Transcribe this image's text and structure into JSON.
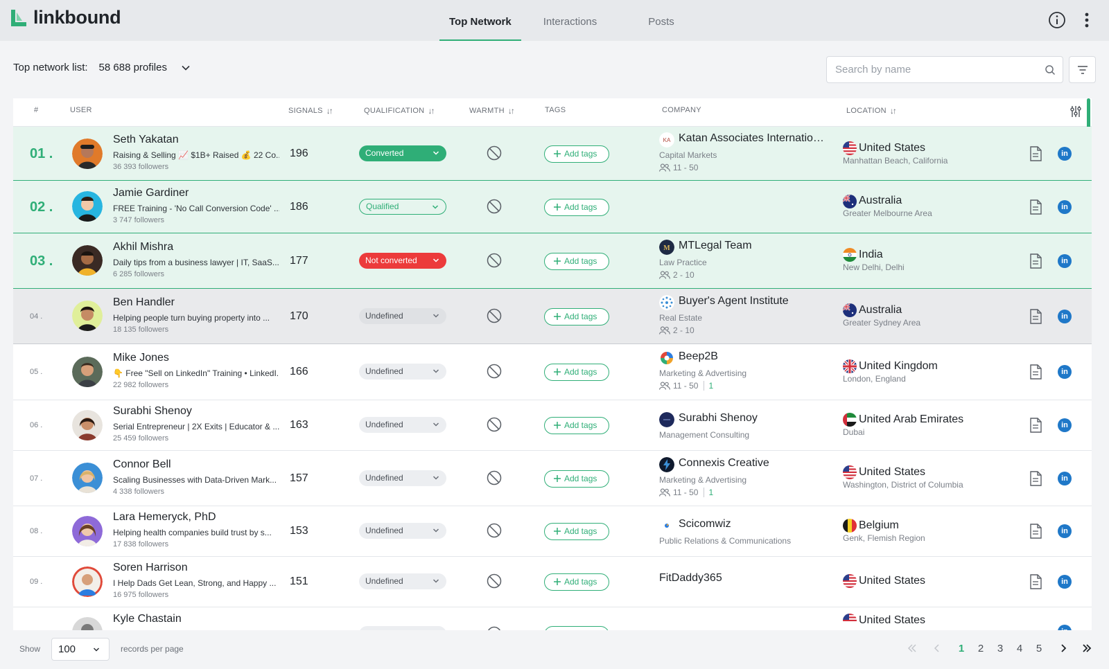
{
  "app": {
    "name": "linkbound"
  },
  "nav": {
    "tabs": [
      {
        "label": "Top Network",
        "active": true
      },
      {
        "label": "Interactions"
      },
      {
        "label": "Posts"
      }
    ]
  },
  "list": {
    "label": "Top network list:",
    "count": "58 688 profiles"
  },
  "search": {
    "placeholder": "Search by name"
  },
  "columns": {
    "rank": "#",
    "user": "USER",
    "signals": "SIGNALS",
    "qualification": "QUALIFICATION",
    "warmth": "WARMTH",
    "tags": "TAGS",
    "company": "COMPANY",
    "location": "LOCATION"
  },
  "add_tags_label": "Add tags",
  "rows": [
    {
      "rank": "01 .",
      "name": "Seth Yakatan",
      "headline": "Raising & Selling 📈 $1B+ Raised 💰 22 Co...",
      "followers": "36 393 followers",
      "signals": "196",
      "qualification": "Converted",
      "company": "Katan Associates Internation...",
      "industry": "Capital Markets",
      "size": "11 - 50",
      "country": "United States",
      "region": "Manhattan Beach, California"
    },
    {
      "rank": "02 .",
      "name": "Jamie Gardiner",
      "headline": "FREE Training - 'No Call Conversion Code' ...",
      "followers": "3 747 followers",
      "signals": "186",
      "qualification": "Qualified",
      "country": "Australia",
      "region": "Greater Melbourne Area"
    },
    {
      "rank": "03 .",
      "name": "Akhil Mishra",
      "headline": "Daily tips from a business lawyer | IT, SaaS...",
      "followers": "6 285 followers",
      "signals": "177",
      "qualification": "Not converted",
      "company": "MTLegal Team",
      "industry": "Law Practice",
      "size": "2 - 10",
      "country": "India",
      "region": "New Delhi, Delhi"
    },
    {
      "rank": "04 .",
      "name": "Ben Handler",
      "headline": "Helping people turn buying property into ...",
      "followers": "18 135 followers",
      "signals": "170",
      "qualification": "Undefined",
      "company": "Buyer's Agent Institute",
      "industry": "Real Estate",
      "size": "2 - 10",
      "country": "Australia",
      "region": "Greater Sydney Area"
    },
    {
      "rank": "05 .",
      "name": "Mike Jones",
      "headline": "👇 Free \"Sell on LinkedIn\" Training • LinkedI...",
      "followers": "22 982 followers",
      "signals": "166",
      "qualification": "Undefined",
      "company": "Beep2B",
      "industry": "Marketing & Advertising",
      "size": "11 - 50",
      "size_extra": "1",
      "country": "United Kingdom",
      "region": "London, England"
    },
    {
      "rank": "06 .",
      "name": "Surabhi Shenoy",
      "headline": "Serial Entrepreneur | 2X Exits | Educator & ...",
      "followers": "25 459 followers",
      "signals": "163",
      "qualification": "Undefined",
      "company": "Surabhi Shenoy",
      "industry": "Management Consulting",
      "country": "United Arab Emirates",
      "region": "Dubai"
    },
    {
      "rank": "07 .",
      "name": "Connor Bell",
      "headline": "Scaling Businesses with Data-Driven Mark...",
      "followers": "4 338 followers",
      "signals": "157",
      "qualification": "Undefined",
      "company": "Connexis Creative",
      "industry": "Marketing & Advertising",
      "size": "11 - 50",
      "size_extra": "1",
      "country": "United States",
      "region": "Washington, District of Columbia"
    },
    {
      "rank": "08 .",
      "name": "Lara Hemeryck, PhD",
      "headline": "Helping health companies build trust by s...",
      "followers": "17 838 followers",
      "signals": "153",
      "qualification": "Undefined",
      "company": "Scicomwiz",
      "industry": "Public Relations & Communications",
      "country": "Belgium",
      "region": "Genk, Flemish Region"
    },
    {
      "rank": "09 .",
      "name": "Soren Harrison",
      "headline": "I Help Dads Get Lean, Strong, and Happy ...",
      "followers": "16 975 followers",
      "signals": "151",
      "qualification": "Undefined",
      "company": "FitDaddy365",
      "country": "United States"
    },
    {
      "rank": "",
      "name": "Kyle Chastain",
      "country": "United States"
    }
  ],
  "footer": {
    "show_label": "Show",
    "per_page": "100",
    "records_label": "records per page",
    "pages": [
      "1",
      "2",
      "3",
      "4",
      "5"
    ]
  },
  "colors": {
    "accent": "#2fae77",
    "danger": "#ec3b3b",
    "linkedin": "#1f78c8"
  }
}
